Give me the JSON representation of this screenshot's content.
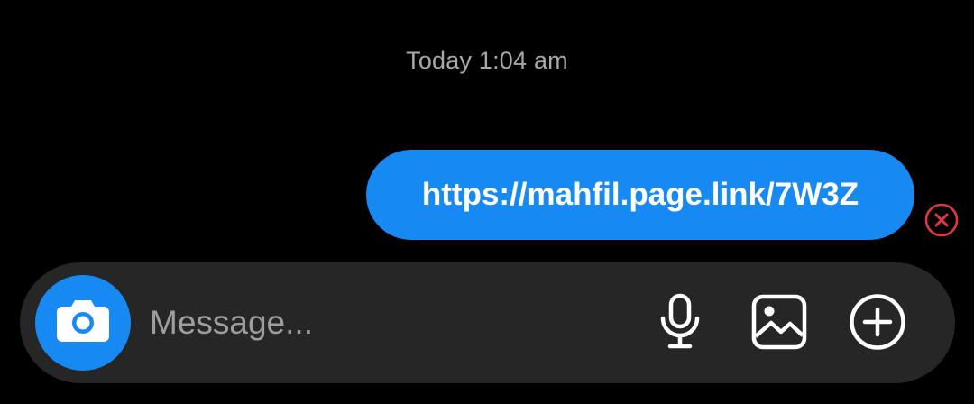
{
  "thread": {
    "timestamp": "Today 1:04 am",
    "messages": [
      {
        "direction": "outgoing",
        "text": "https://mahfil.page.link/7W3Z",
        "status": "failed",
        "status_icon": "error-x-circle-icon"
      }
    ]
  },
  "composer": {
    "placeholder": "Message...",
    "value": "",
    "icons": {
      "camera": "camera-icon",
      "mic": "microphone-icon",
      "gallery": "gallery-image-icon",
      "plus": "plus-circle-icon"
    }
  },
  "colors": {
    "background": "#000000",
    "accent_blue": "#1689f2",
    "composer_bg": "#262626",
    "timestamp_text": "#a8a8a8",
    "error_red": "#e0383e"
  }
}
